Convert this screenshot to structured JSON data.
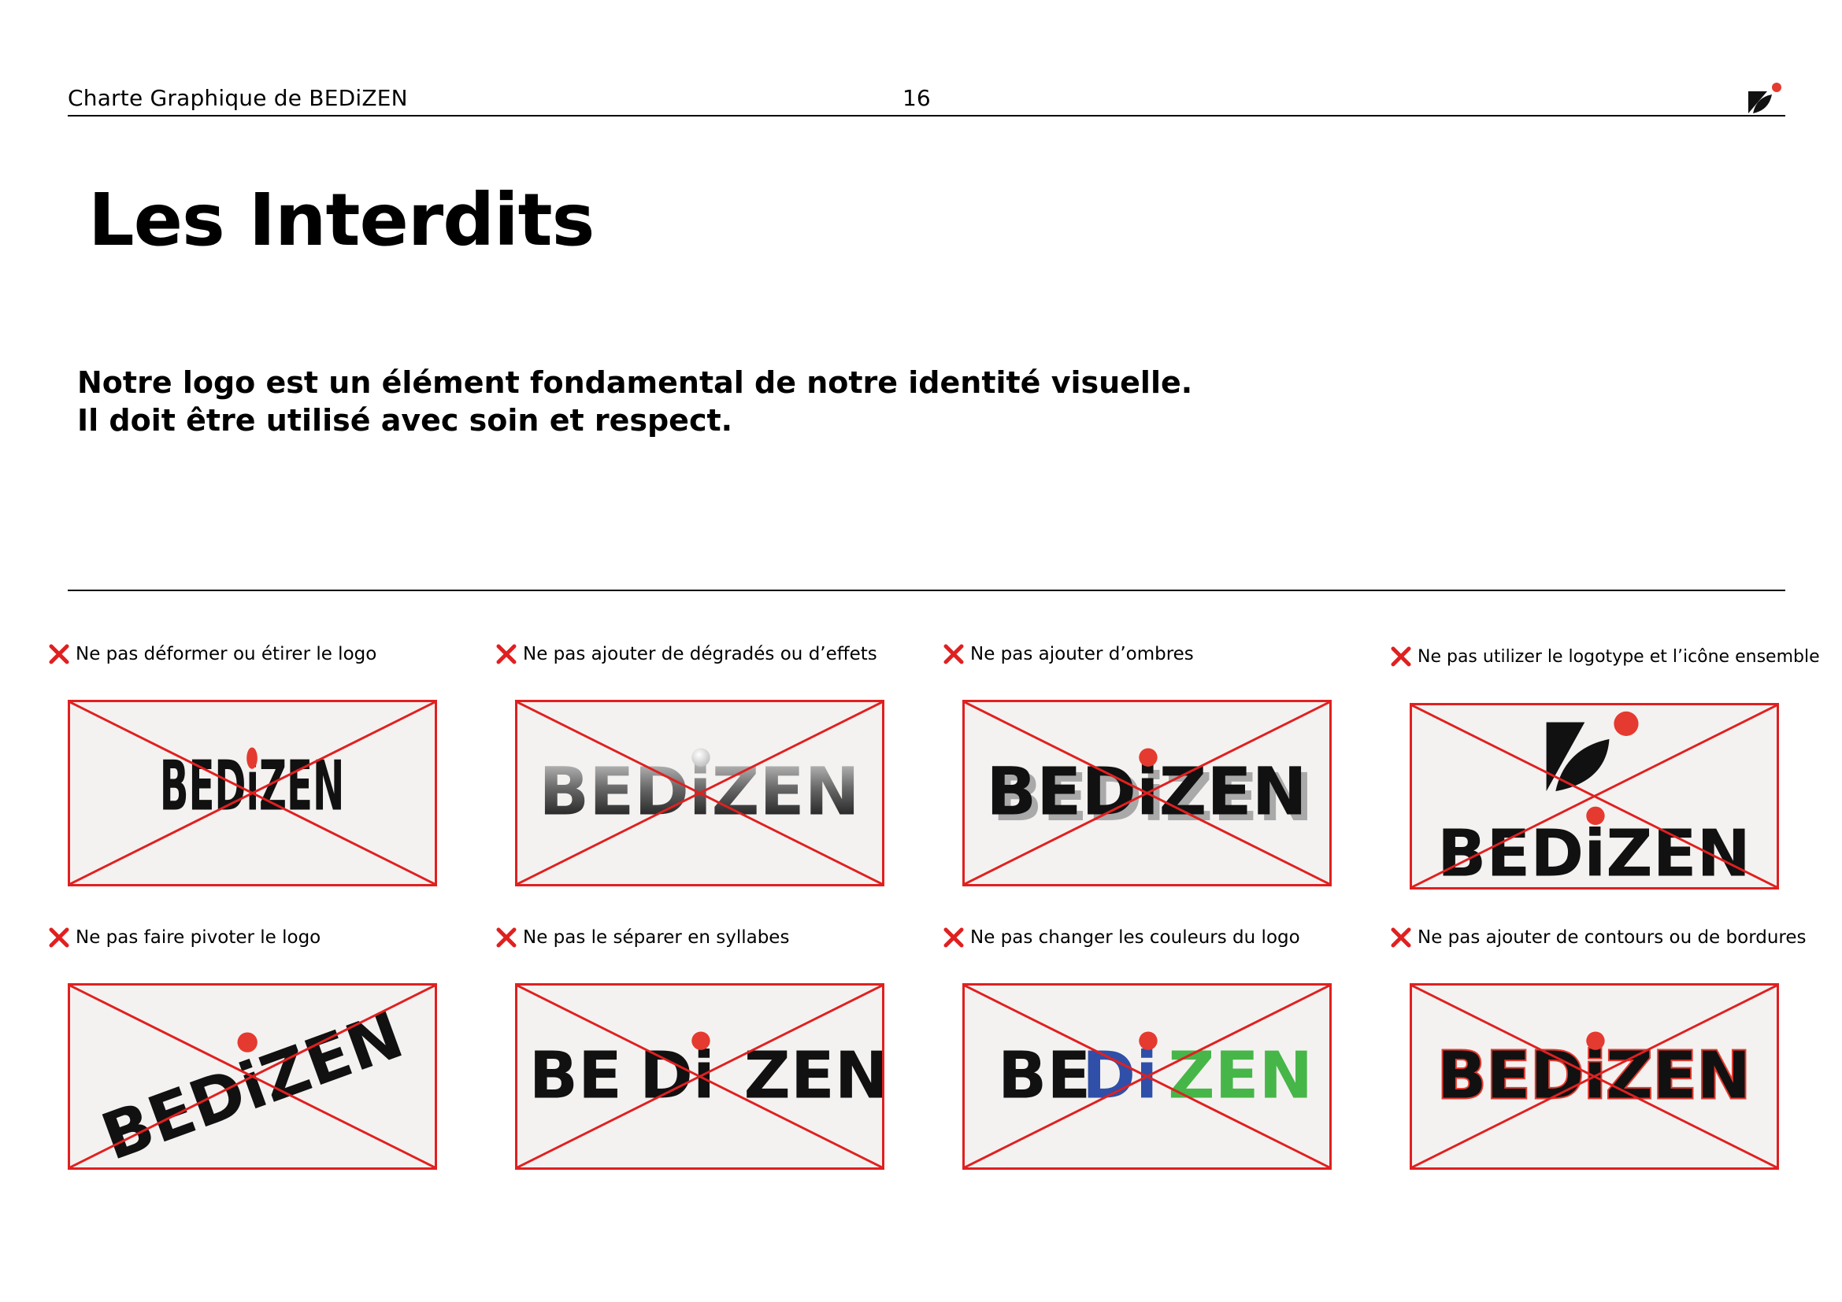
{
  "header": {
    "title": "Charte Graphique de BEDiZEN",
    "page_number": "16",
    "logo_icon": "bedizen-icon"
  },
  "page_title": "Les Interdits",
  "intro": {
    "line1": "Notre logo est un élément fondamental de notre identité visuelle.",
    "line2": "Il doit être utilisé avec soin et respect."
  },
  "colors": {
    "accent_red": "#e02020",
    "logo_black": "#111111",
    "dot_red": "#e53a2f",
    "panel_bg": "#f4f2f0",
    "wrong_blue": "#2f4fa8",
    "wrong_green": "#46b648"
  },
  "logo_text": {
    "full": "BEDiZEN",
    "syllable1": "BE",
    "syllable2": "Di",
    "syllable3": "ZEN"
  },
  "rules": [
    {
      "id": "stretch",
      "caption": "Ne pas déformer ou étirer le logo",
      "icon": "cross-icon"
    },
    {
      "id": "gradient",
      "caption": "Ne pas ajouter de dégradés ou d’effets",
      "icon": "cross-icon"
    },
    {
      "id": "shadow",
      "caption": "Ne pas ajouter d’ombres",
      "icon": "cross-icon"
    },
    {
      "id": "stacked",
      "caption": "Ne pas utilizer le logotype et l’icône ensemble",
      "icon": "cross-icon"
    },
    {
      "id": "rotate",
      "caption": "Ne pas faire pivoter le logo",
      "icon": "cross-icon"
    },
    {
      "id": "syllables",
      "caption": "Ne pas le séparer en syllabes",
      "icon": "cross-icon"
    },
    {
      "id": "colors",
      "caption": "Ne pas changer les couleurs du logo",
      "icon": "cross-icon"
    },
    {
      "id": "outline",
      "caption": "Ne pas ajouter de contours ou de bordures",
      "icon": "cross-icon"
    }
  ]
}
